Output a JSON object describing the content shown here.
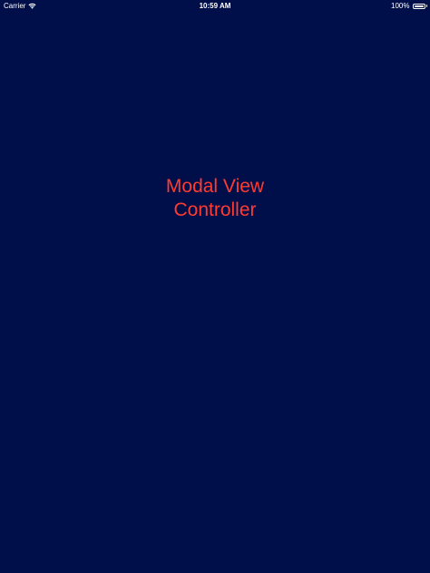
{
  "status_bar": {
    "carrier": "Carrier",
    "wifi_icon": "wifi-icon",
    "time": "10:59 AM",
    "battery_percent": "100%",
    "battery_level": 1.0,
    "battery_icon": "battery-icon"
  },
  "main": {
    "title_line1": "Modal View",
    "title_line2": "Controller",
    "title_color": "#ff3b30"
  },
  "colors": {
    "background": "#000e4a",
    "status_text": "#ffffff"
  }
}
